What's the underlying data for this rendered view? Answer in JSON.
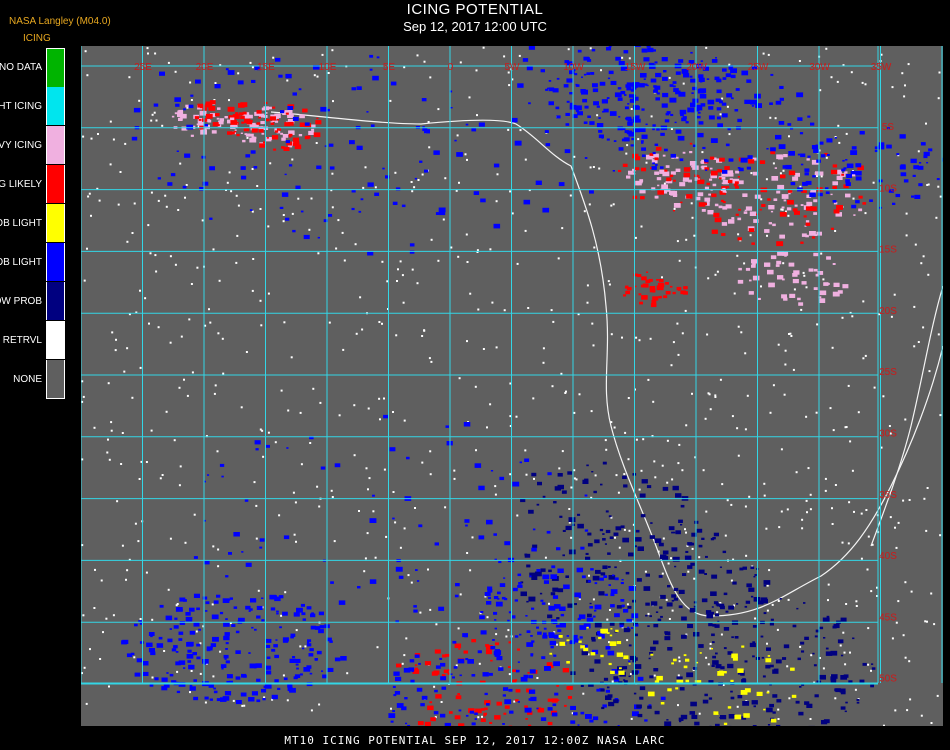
{
  "header": {
    "title": "ICING POTENTIAL",
    "subtitle": "Sep 12, 2017 12:00 UTC",
    "provider": "NASA Langley (M04.0)",
    "product": "ICING"
  },
  "legend": [
    {
      "label": "NO DATA",
      "color": "#00b400"
    },
    {
      "label": "NIGHT ICING",
      "color": "#00e5ee"
    },
    {
      "label": "HEAVY ICING",
      "color": "#f0b0e0"
    },
    {
      "label": "MOG LIKELY",
      "color": "#ff0000"
    },
    {
      "label": "HI PROB LIGHT",
      "color": "#ffff00"
    },
    {
      "label": "LO PROB LIGHT",
      "color": "#0000ff"
    },
    {
      "label": "LOW PROB",
      "color": "#000080"
    },
    {
      "label": "NO RETRVL",
      "color": "#ffffff"
    },
    {
      "label": "NONE",
      "color": "#5f5f5f"
    }
  ],
  "map": {
    "background_color": "#5f5f5f",
    "grid_color": "#33d6e6",
    "grid_label_color": "#cc1a1a",
    "top_lon_labels": [
      "25E",
      "20E",
      "15E",
      "10E",
      "5E",
      "0",
      "5W",
      "10W",
      "15W",
      "20W",
      "25W",
      "30W",
      "35W"
    ],
    "right_lat_labels": [
      "5S",
      "10S",
      "15S",
      "20S",
      "25S",
      "30S",
      "35S",
      "40S",
      "45S",
      "50S"
    ]
  },
  "footer": "MT10  ICING POTENTIAL   SEP 12, 2017 12:00Z   NASA LARC"
}
